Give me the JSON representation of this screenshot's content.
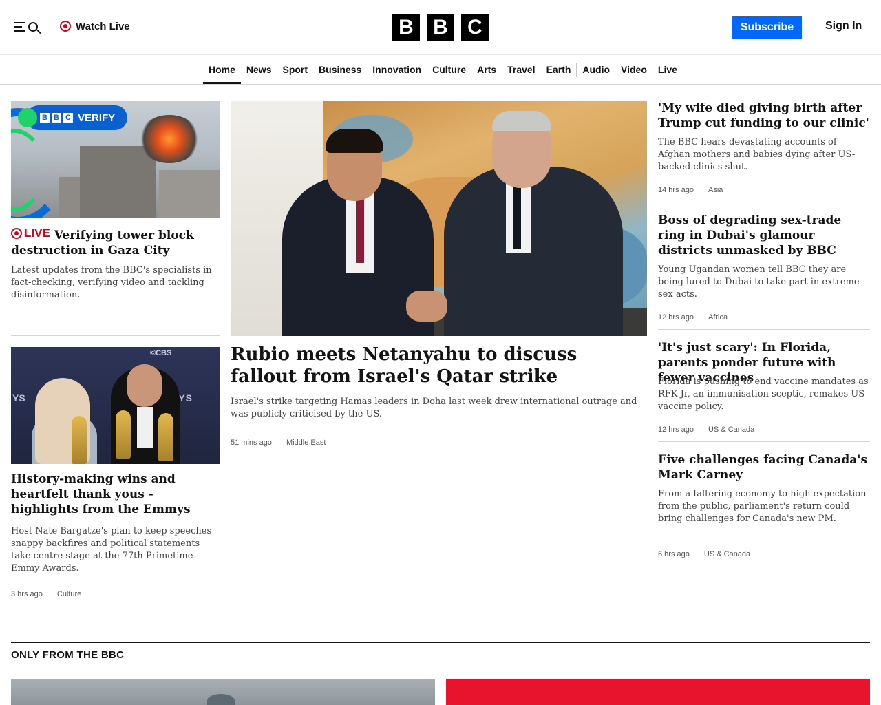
{
  "header": {
    "watch_live": "Watch Live",
    "logo_letters": [
      "B",
      "B",
      "C"
    ],
    "subscribe": "Subscribe",
    "sign_in": "Sign In"
  },
  "nav": {
    "items": [
      "Home",
      "News",
      "Sport",
      "Business",
      "Innovation",
      "Culture",
      "Arts",
      "Travel",
      "Earth",
      "Audio",
      "Video",
      "Live"
    ],
    "active": "Home"
  },
  "stories": {
    "verify": {
      "badge_text": "VERIFY",
      "badge_letters": [
        "B",
        "B",
        "C"
      ],
      "live_label": "LIVE",
      "headline": "Verifying tower block destruction in Gaza City",
      "summary": "Latest updates from the BBC's specialists in fact-checking, verifying video and tackling disinformation."
    },
    "emmys": {
      "image_text_left": "YS",
      "image_text_right": "MMYS",
      "image_text_cbs": "©CBS",
      "headline": "History-making wins and heartfelt thank yous - highlights from the Emmys",
      "summary": "Host Nate Bargatze's plan to keep speeches snappy backfires and political statements take centre stage at the 77th Primetime Emmy Awards.",
      "time": "3 hrs ago",
      "category": "Culture"
    },
    "main": {
      "headline": "Rubio meets Netanyahu to discuss fallout from Israel's Qatar strike",
      "summary": "Israel's strike targeting Hamas leaders in Doha last week drew international outrage and was publicly criticised by the US.",
      "time": "51 mins ago",
      "category": "Middle East"
    },
    "right": [
      {
        "headline": "'My wife died giving birth after Trump cut funding to our clinic'",
        "summary": "The BBC hears devastating accounts of Afghan mothers and babies dying after US-backed clinics shut.",
        "time": "14 hrs ago",
        "category": "Asia"
      },
      {
        "headline": "Boss of degrading sex-trade ring in Dubai's glamour districts unmasked by BBC",
        "summary": "Young Ugandan women tell BBC they are being lured to Dubai to take part in extreme sex acts.",
        "time": "12 hrs ago",
        "category": "Africa"
      },
      {
        "headline": "'It's just scary': In Florida, parents ponder future with fewer vaccines",
        "summary": "Florida is pushing to end vaccine mandates as RFK Jr, an immunisation sceptic, remakes US vaccine policy.",
        "time": "12 hrs ago",
        "category": "US & Canada"
      },
      {
        "headline": "Five challenges facing Canada's Mark Carney",
        "summary": "From a faltering economy to high expectation from the public, parliament's return could bring challenges for Canada's new PM.",
        "time": "6 hrs ago",
        "category": "US & Canada"
      }
    ]
  },
  "section": {
    "title": "ONLY FROM THE BBC"
  },
  "icons": {
    "menu": "menu-icon",
    "search": "search-icon",
    "live": "live-dot-icon"
  },
  "colors": {
    "accent_blue": "#0068ff",
    "live_red": "#d4001a",
    "text": "#141414"
  }
}
